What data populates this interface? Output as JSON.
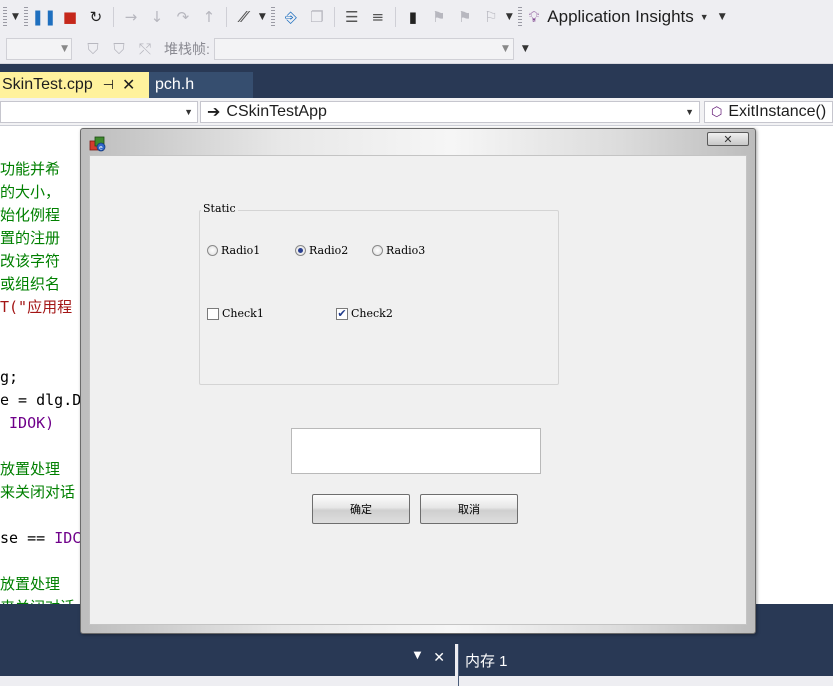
{
  "toolbar": {
    "insights_label": "Application Insights",
    "stack_frame_label": "堆栈帧:"
  },
  "tabs": [
    {
      "label": "SkinTest.cpp",
      "active": true
    },
    {
      "label": "pch.h",
      "active": false
    }
  ],
  "navbar": {
    "class_combo": "CSkinTestApp",
    "member_combo": "ExitInstance()"
  },
  "code": {
    "lines": [
      {
        "text": "功能并希",
        "kind": "comment"
      },
      {
        "text": "的大小，",
        "kind": "comment"
      },
      {
        "text": "始化例程",
        "kind": "comment"
      },
      {
        "text": "置的注册",
        "kind": "comment"
      },
      {
        "text": "改该字符",
        "kind": "comment"
      },
      {
        "text": "或组织名",
        "kind": "comment"
      },
      {
        "text": "T(\"应用程",
        "kind": "str"
      },
      {
        "text": "",
        "kind": "plain"
      },
      {
        "text": "",
        "kind": "plain"
      },
      {
        "text": "g;",
        "kind": "plain"
      },
      {
        "text": "e = dlg.Do",
        "kind": "plain"
      },
      {
        "text": " IDOK)",
        "kind": "macro"
      },
      {
        "text": "",
        "kind": "plain"
      },
      {
        "text": "放置处理",
        "kind": "comment"
      },
      {
        "text": "来关闭对话",
        "kind": "comment"
      },
      {
        "text": "",
        "kind": "plain"
      },
      {
        "text": "se == IDCA",
        "kind": "mixed"
      },
      {
        "text": "",
        "kind": "plain"
      },
      {
        "text": "放置处理",
        "kind": "comment"
      },
      {
        "text": "来关闭对话",
        "kind": "comment"
      }
    ]
  },
  "dialog": {
    "group_title": "Static",
    "radios": [
      {
        "label": "Radio1",
        "checked": false
      },
      {
        "label": "Radio2",
        "checked": true
      },
      {
        "label": "Radio3",
        "checked": false
      }
    ],
    "checks": [
      {
        "label": "Check1",
        "checked": false
      },
      {
        "label": "Check2",
        "checked": true
      }
    ],
    "edit_value": "",
    "ok_label": "确定",
    "cancel_label": "取消",
    "close_glyph": "✕"
  },
  "panels": {
    "memory_title": "内存 1"
  },
  "colors": {
    "ide_dark": "#293955",
    "active_tab": "#fff29d",
    "comment": "#008000",
    "string": "#a31515",
    "macro": "#6f008a"
  },
  "icons": [
    "pause-icon",
    "stop-icon",
    "restart-icon",
    "step-icon",
    "bulb-icon",
    "bookmark-icon",
    "filter-icon",
    "pin-icon",
    "close-icon",
    "arrow-right-icon",
    "class-icon",
    "app-icon"
  ]
}
